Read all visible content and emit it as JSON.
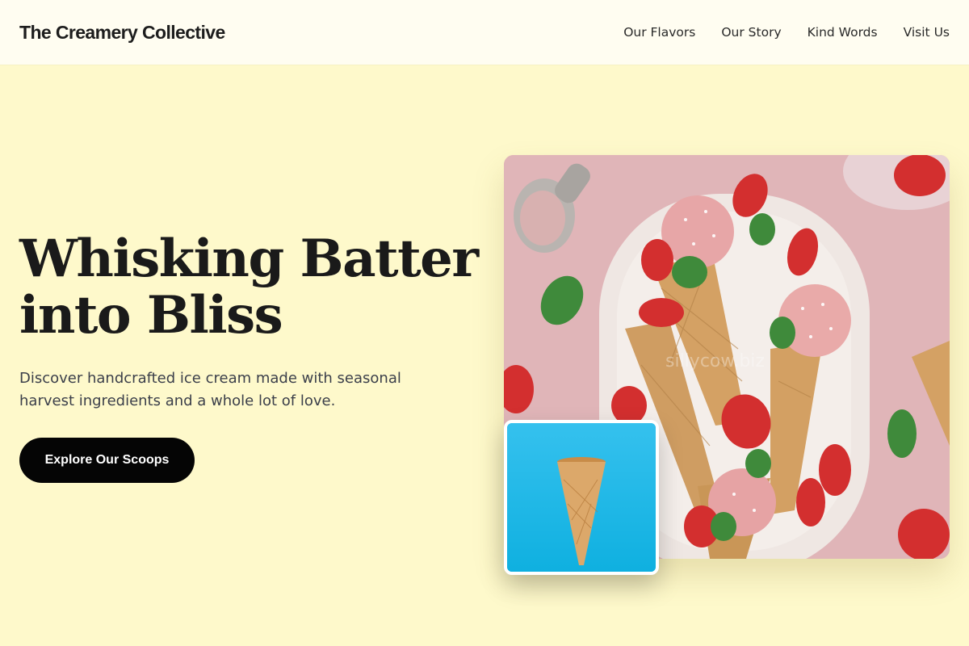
{
  "header": {
    "brand": "The Creamery Collective",
    "nav": [
      {
        "label": "Our Flavors"
      },
      {
        "label": "Our Story"
      },
      {
        "label": "Kind Words"
      },
      {
        "label": "Visit Us"
      }
    ]
  },
  "hero": {
    "title_line1": "Whisking Batter",
    "title_line2": "into Bliss",
    "description": "Discover handcrafted ice cream made with seasonal harvest ingredients and a whole lot of love.",
    "cta_label": "Explore Our Scoops"
  },
  "images": {
    "main_watermark": "sillycow.biz",
    "main_subject": "strawberry ice cream cones on plate",
    "thumb_subject": "empty waffle cone on blue background"
  },
  "colors": {
    "page_bg": "#fef9cb",
    "header_bg": "#fffdf1",
    "cta_bg": "#050505",
    "photo_pink": "#e0b5b8",
    "thumb_blue": "#12b5e6"
  }
}
